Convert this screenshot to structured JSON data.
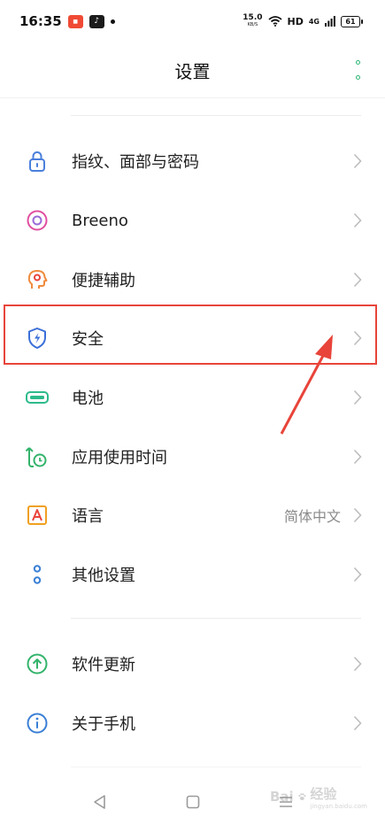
{
  "status_bar": {
    "time": "16:35",
    "net_speed": "15.0",
    "net_unit": "KB/S",
    "hd": "HD",
    "signal": "4G",
    "battery": "61"
  },
  "header": {
    "title": "设置"
  },
  "items_group1": [
    {
      "label": "指纹、面部与密码",
      "icon": "lock-icon",
      "color": "#4a7fdc"
    },
    {
      "label": "Breeno",
      "icon": "breeno-icon",
      "color": "#e04fa0"
    },
    {
      "label": "便捷辅助",
      "icon": "accessibility-head-icon",
      "color": "#f08a3c"
    },
    {
      "label": "安全",
      "icon": "shield-icon",
      "color": "#3a6fd8"
    },
    {
      "label": "电池",
      "icon": "battery-icon",
      "color": "#2dbb8a"
    },
    {
      "label": "应用使用时间",
      "icon": "app-timer-icon",
      "color": "#33b36b"
    },
    {
      "label": "语言",
      "icon": "language-icon",
      "color": "#f0a020",
      "value": "简体中文"
    },
    {
      "label": "其他设置",
      "icon": "more-settings-icon",
      "color": "#3a7fd6"
    }
  ],
  "items_group2": [
    {
      "label": "软件更新",
      "icon": "update-icon",
      "color": "#33b36b"
    },
    {
      "label": "关于手机",
      "icon": "info-icon",
      "color": "#3a7fd6"
    }
  ],
  "watermark": {
    "brand": "Bai",
    "suffix": "经验",
    "sub": "jingyan.baidu.com"
  }
}
